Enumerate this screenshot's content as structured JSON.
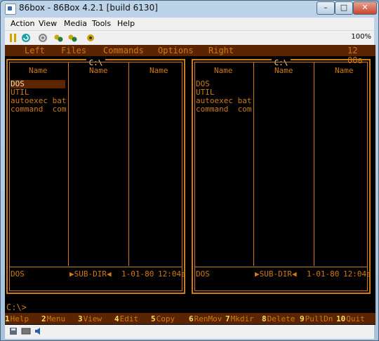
{
  "window": {
    "title": "86box - 86Box 4.2.1 [build 6130]",
    "buttons": {
      "minimize": "–",
      "maximize": "□",
      "close": "✕"
    }
  },
  "menubar": {
    "items": [
      "Action",
      "View",
      "Media",
      "Tools",
      "Help"
    ]
  },
  "toolbar": {
    "zoom": "100%",
    "icons": [
      "pause-icon",
      "reset-icon",
      "power-icon",
      "settings-icon",
      "settings-icon",
      "settings-icon"
    ]
  },
  "dos": {
    "top_menu": [
      "Left",
      "Files",
      "Commands",
      "Options",
      "Right"
    ],
    "clock": "12 00a",
    "left_panel": {
      "path": "C:\\",
      "column_headers": [
        "Name",
        "Name",
        "Name"
      ],
      "files": [
        {
          "name": "DOS",
          "ext": ""
        },
        {
          "name": "UTIL",
          "ext": ""
        },
        {
          "name": "autoexec",
          "ext": "bat"
        },
        {
          "name": "command",
          "ext": "com"
        }
      ],
      "status": {
        "name": "DOS",
        "type": "▶SUB-DIR◀",
        "date": "1-01-80",
        "time": "12:04a"
      }
    },
    "right_panel": {
      "path": "C:\\",
      "column_headers": [
        "Name",
        "Name",
        "Name"
      ],
      "files": [
        {
          "name": "DOS",
          "ext": ""
        },
        {
          "name": "UTIL",
          "ext": ""
        },
        {
          "name": "autoexec",
          "ext": "bat"
        },
        {
          "name": "command",
          "ext": "com"
        }
      ],
      "status": {
        "name": "DOS",
        "type": "▶SUB-DIR◀",
        "date": "1-01-80",
        "time": "12:04a"
      }
    },
    "prompt": "C:\\>",
    "function_keys": [
      {
        "num": "1",
        "label": "Help"
      },
      {
        "num": "2",
        "label": "Menu"
      },
      {
        "num": "3",
        "label": "View"
      },
      {
        "num": "4",
        "label": "Edit"
      },
      {
        "num": "5",
        "label": "Copy"
      },
      {
        "num": "6",
        "label": "RenMov"
      },
      {
        "num": "7",
        "label": "Mkdir"
      },
      {
        "num": "8",
        "label": "Delete"
      },
      {
        "num": "9",
        "label": "PullDn"
      },
      {
        "num": "10",
        "label": "Quit"
      }
    ]
  },
  "statusbar": {
    "icons": [
      "floppy-icon",
      "network-icon",
      "sound-icon"
    ]
  }
}
